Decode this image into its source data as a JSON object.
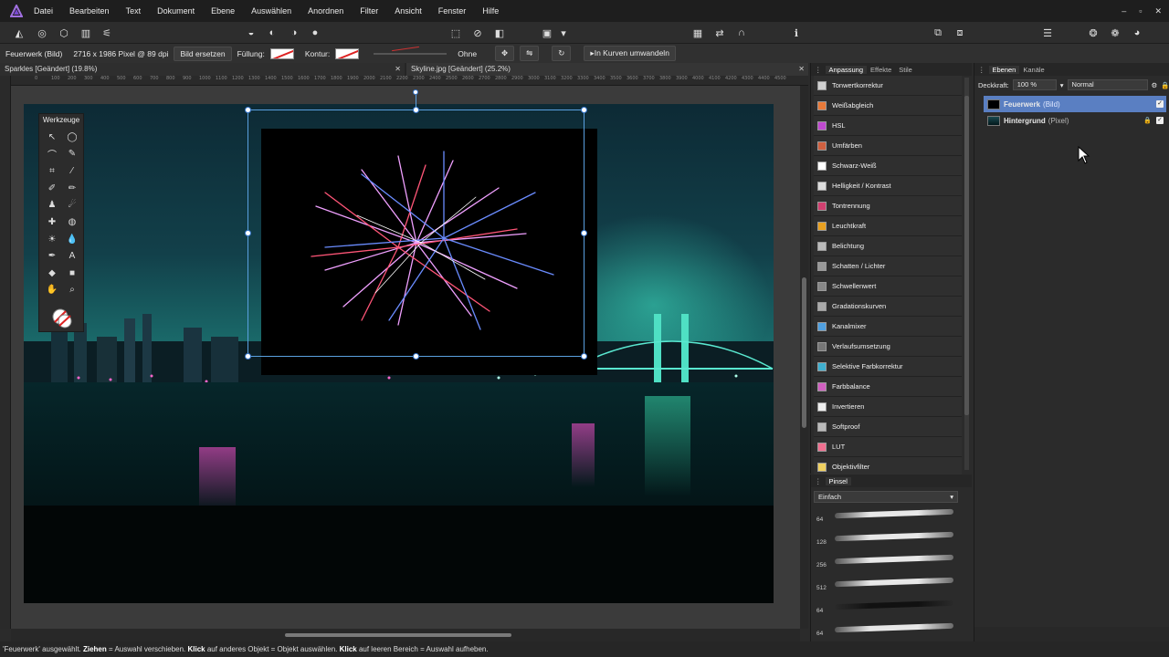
{
  "menubar": {
    "items": [
      "Datei",
      "Bearbeiten",
      "Text",
      "Dokument",
      "Ebene",
      "Auswählen",
      "Anordnen",
      "Filter",
      "Ansicht",
      "Fenster",
      "Hilfe"
    ],
    "window_controls": [
      "–",
      "▫",
      "✕"
    ]
  },
  "contextbar": {
    "layer_name": "Feuerwerk (Bild)",
    "image_info": "2716 x 1986 Pixel @ 89 dpi",
    "replace_button": "Bild ersetzen",
    "fill_label": "Füllung:",
    "stroke_label": "Kontur:",
    "stroke_style": "Ohne",
    "convert_button": "In Kurven umwandeln"
  },
  "doctabs": [
    {
      "label": "Sparkles [Geändert] (19.8%)",
      "close": "✕"
    },
    {
      "label": "Skyline.jpg [Geändert] (25.2%)",
      "close": "✕"
    }
  ],
  "ruler": {
    "ticks": [
      "0",
      "100",
      "200",
      "300",
      "400",
      "500",
      "600",
      "700",
      "800",
      "900",
      "1000",
      "1100",
      "1200",
      "1300",
      "1400",
      "1500",
      "1600",
      "1700",
      "1800",
      "1900",
      "2000",
      "2100",
      "2200",
      "2300",
      "2400",
      "2500",
      "2600",
      "2700",
      "2800",
      "2900",
      "3000",
      "3100",
      "3200",
      "3300",
      "3400",
      "3500",
      "3600",
      "3700",
      "3800",
      "3900",
      "4000",
      "4100",
      "4200",
      "4300",
      "4400",
      "4500"
    ]
  },
  "tools_panel": {
    "title": "Werkzeuge"
  },
  "adjustments_panel": {
    "tabs": [
      "Anpassung",
      "Effekte",
      "Stile"
    ],
    "items": [
      {
        "label": "Tonwertkorrektur",
        "color": "#cfcfcf"
      },
      {
        "label": "Weißabgleich",
        "color": "#e87a3a"
      },
      {
        "label": "HSL",
        "color": "#c04ad0"
      },
      {
        "label": "Umfärben",
        "color": "#d06040"
      },
      {
        "label": "Schwarz-Weiß",
        "color": "#ffffff"
      },
      {
        "label": "Helligkeit / Kontrast",
        "color": "#dddddd"
      },
      {
        "label": "Tontrennung",
        "color": "#d04070"
      },
      {
        "label": "Leuchtkraft",
        "color": "#e8a020"
      },
      {
        "label": "Belichtung",
        "color": "#bbbbbb"
      },
      {
        "label": "Schatten / Lichter",
        "color": "#999999"
      },
      {
        "label": "Schwellenwert",
        "color": "#888888"
      },
      {
        "label": "Gradationskurven",
        "color": "#aaaaaa"
      },
      {
        "label": "Kanalmixer",
        "color": "#50a0e0"
      },
      {
        "label": "Verlaufsumsetzung",
        "color": "#777777"
      },
      {
        "label": "Selektive Farbkorrektur",
        "color": "#40b0d0"
      },
      {
        "label": "Farbbalance",
        "color": "#d060c0"
      },
      {
        "label": "Invertieren",
        "color": "#eeeeee"
      },
      {
        "label": "Softproof",
        "color": "#bbbbbb"
      },
      {
        "label": "LUT",
        "color": "#f07090"
      },
      {
        "label": "Objektivfilter",
        "color": "#f0d060"
      }
    ]
  },
  "brushes_panel": {
    "title": "Pinsel",
    "category": "Einfach",
    "sizes": [
      "64",
      "128",
      "256",
      "512",
      "64",
      "64"
    ]
  },
  "layers_panel": {
    "tabs": [
      "Ebenen",
      "Kanäle"
    ],
    "opacity_label": "Deckkraft:",
    "opacity_value": "100 %",
    "blend_mode": "Normal",
    "layers": [
      {
        "name": "Feuerwerk",
        "kind": "(Bild)",
        "selected": true,
        "checked": "✓"
      },
      {
        "name": "Hintergrund",
        "kind": "(Pixel)",
        "selected": false,
        "checked": "✓"
      }
    ]
  },
  "statusbar": {
    "part1": "'Feuerwerk' ausgewählt. ",
    "b1": "Ziehen",
    "part2": " = Auswahl verschieben. ",
    "b2": "Klick",
    "part3": " auf anderes Objekt = Objekt auswählen. ",
    "b3": "Klick",
    "part4": " auf leeren Bereich = Auswahl aufheben."
  }
}
